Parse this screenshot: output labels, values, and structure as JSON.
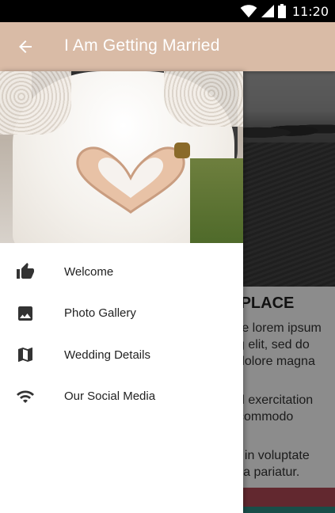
{
  "status_bar": {
    "time": "11:20",
    "icons": [
      "wifi-icon",
      "signal-icon",
      "battery-icon"
    ]
  },
  "app_bar": {
    "title": "I Am Getting Married",
    "back_icon": "arrow-back-icon",
    "color": "#d9bba6"
  },
  "background": {
    "heading": "PLACE",
    "text_lines": [
      "re lorem ipsum",
      "g elit, sed do",
      "dolore magna",
      "d exercitation",
      " commodo",
      "t in voluptate",
      "lla pariatur."
    ]
  },
  "drawer": {
    "header_image": "wedding-heart-hands-photo",
    "items": [
      {
        "label": "Welcome",
        "icon": "thumb-up-icon"
      },
      {
        "label": "Photo Gallery",
        "icon": "image-icon"
      },
      {
        "label": "Wedding Details",
        "icon": "map-icon"
      },
      {
        "label": "Our Social Media",
        "icon": "wifi-icon"
      }
    ]
  }
}
